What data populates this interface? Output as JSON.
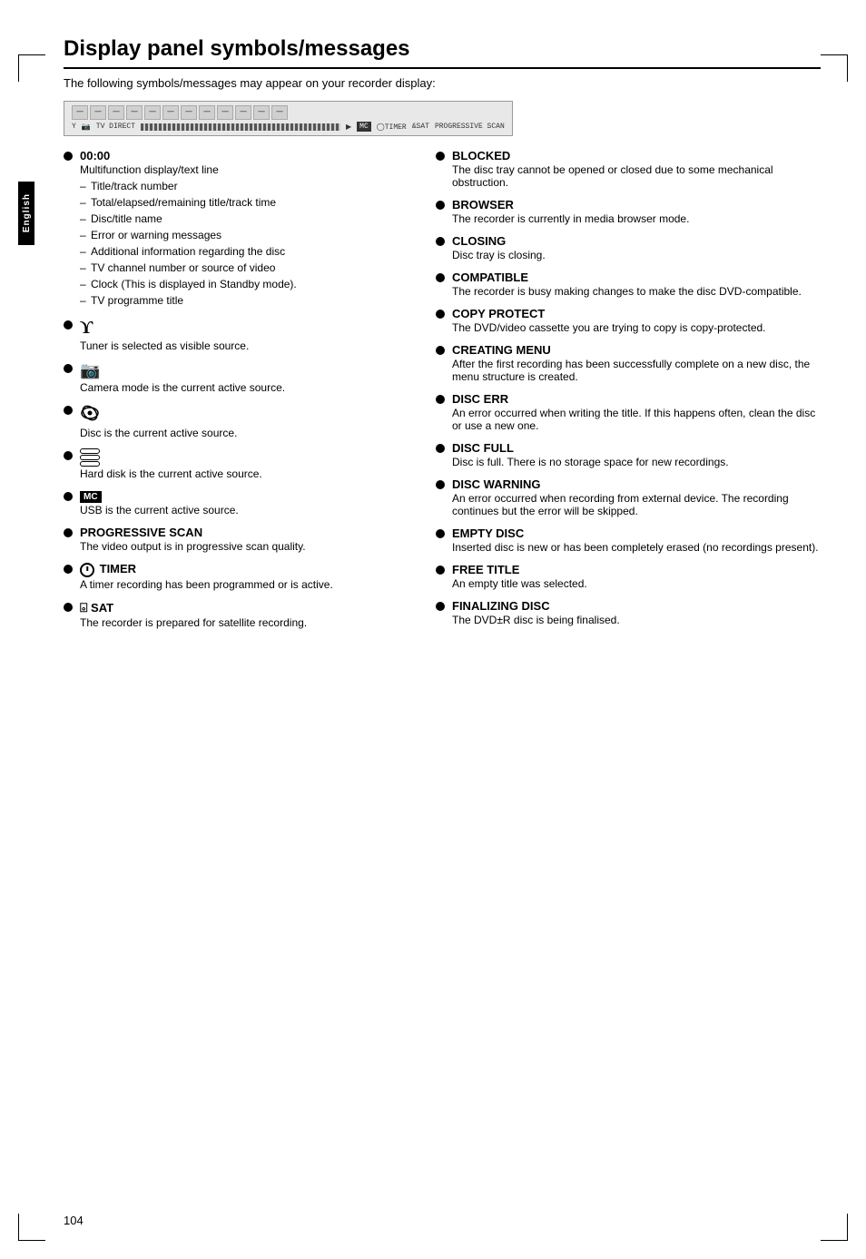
{
  "page": {
    "title": "Display panel symbols/messages",
    "intro": "The following symbols/messages may appear on your recorder display:",
    "page_number": "104",
    "sidebar_label": "English"
  },
  "left_items": [
    {
      "id": "time-display",
      "title": "00:00",
      "desc": "Multifunction display/text line",
      "sub": [
        "Title/track number",
        "Total/elapsed/remaining title/track time",
        "Disc/title name",
        "Error or warning messages",
        "Additional information regarding the disc",
        "TV channel number or source of video",
        "Clock (This is displayed in Standby mode).",
        "TV programme title"
      ]
    },
    {
      "id": "tuner-icon",
      "title": "",
      "icon_type": "tuner",
      "desc": "Tuner is selected as visible source."
    },
    {
      "id": "camera-icon",
      "title": "",
      "icon_type": "camera",
      "desc": "Camera mode is the current active source."
    },
    {
      "id": "disc-icon",
      "title": "",
      "icon_type": "disc",
      "desc": "Disc is the current active source."
    },
    {
      "id": "harddisk-icon",
      "title": "",
      "icon_type": "harddisk",
      "desc": "Hard disk is the current active source."
    },
    {
      "id": "mc-icon",
      "title": "",
      "icon_type": "mc",
      "desc": "USB is the current active source."
    },
    {
      "id": "progressive-scan",
      "title": "PROGRESSIVE SCAN",
      "desc": "The video output is in progressive scan quality."
    },
    {
      "id": "timer",
      "title": "TIMER",
      "icon_type": "timer",
      "desc": "A timer recording has been programmed or is active."
    },
    {
      "id": "sat",
      "title": "SAT",
      "icon_type": "sat",
      "desc": "The recorder is prepared for satellite recording."
    }
  ],
  "right_items": [
    {
      "id": "blocked",
      "title": "BLOCKED",
      "desc": "The disc tray cannot be opened or closed due to some mechanical obstruction."
    },
    {
      "id": "browser",
      "title": "BROWSER",
      "desc": "The recorder is currently in media browser mode."
    },
    {
      "id": "closing",
      "title": "CLOSING",
      "desc": "Disc tray is closing."
    },
    {
      "id": "compatible",
      "title": "COMPATIBLE",
      "desc": "The recorder is busy making changes to make the disc DVD-compatible."
    },
    {
      "id": "copy-protect",
      "title": "COPY PROTECT",
      "desc": "The DVD/video cassette you are trying to copy is copy-protected."
    },
    {
      "id": "creating-menu",
      "title": "CREATING MENU",
      "desc": "After the first recording has been successfully complete on a new disc, the menu structure is created."
    },
    {
      "id": "disc-err",
      "title": "DISC ERR",
      "desc": "An error occurred when writing the title. If this happens often, clean the disc or use a new one."
    },
    {
      "id": "disc-full",
      "title": "DISC FULL",
      "desc": "Disc is full. There is no storage space for new recordings."
    },
    {
      "id": "disc-warning",
      "title": "DISC WARNING",
      "desc": "An error occurred when recording from external device. The recording continues but the error will be skipped."
    },
    {
      "id": "empty-disc",
      "title": "EMPTY DISC",
      "desc": "Inserted disc is new or has been completely erased (no recordings present)."
    },
    {
      "id": "free-title",
      "title": "FREE TITLE",
      "desc": "An empty title was selected."
    },
    {
      "id": "finalizing-disc",
      "title": "FINALIZING DISC",
      "desc": "The DVD±R disc is being finalised."
    }
  ]
}
